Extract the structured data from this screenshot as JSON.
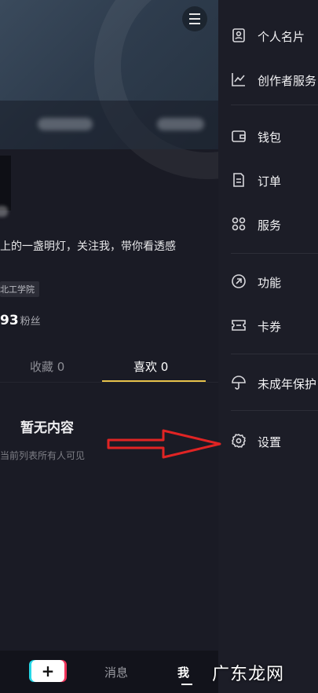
{
  "profile": {
    "bio": "上的一盏明灯，关注我，带你看透感",
    "school": "北工学院",
    "fans_count": "93",
    "fans_label": "粉丝",
    "tabs": [
      {
        "label": "收藏 0"
      },
      {
        "label": "喜欢 0"
      }
    ],
    "empty_title": "暂无内容",
    "empty_sub": "当前列表所有人可见"
  },
  "bottom_nav": {
    "add_label": "+",
    "messages_label": "消息",
    "me_label": "我"
  },
  "drawer": {
    "items": [
      {
        "label": "个人名片",
        "icon": "profile-card-icon"
      },
      {
        "label": "创作者服务",
        "icon": "chart-line-icon"
      },
      {
        "label": "钱包",
        "icon": "wallet-icon"
      },
      {
        "label": "订单",
        "icon": "order-icon"
      },
      {
        "label": "服务",
        "icon": "grid-cluster-icon"
      },
      {
        "label": "功能",
        "icon": "function-icon"
      },
      {
        "label": "卡券",
        "icon": "coupon-icon"
      },
      {
        "label": "未成年保护",
        "icon": "umbrella-icon"
      },
      {
        "label": "设置",
        "icon": "gear-icon"
      }
    ]
  },
  "annotation": {
    "arrow_color": "#e02424"
  },
  "watermark": {
    "text": "广东龙网"
  }
}
